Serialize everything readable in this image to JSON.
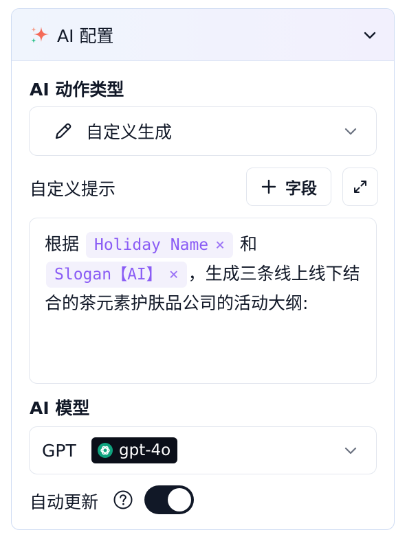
{
  "header": {
    "title": "AI 配置",
    "icon": "sparkle-icon",
    "collapse_icon": "chevron-down-icon"
  },
  "action_type": {
    "label": "AI 动作类型",
    "selected": "自定义生成",
    "icon": "pencil-icon"
  },
  "custom_prompt": {
    "label": "自定义提示",
    "add_field_label": "字段",
    "expand_icon": "expand-icon",
    "text_before": "根据",
    "chip1": "Holiday Name",
    "text_mid": "和",
    "chip2": "Slogan【AI】",
    "chip_remove": "×",
    "text_after": "，生成三条线上线下结合的茶元素护肤品公司的活动大纲:"
  },
  "model": {
    "label": "AI 模型",
    "provider": "GPT",
    "model_name": "gpt-4o"
  },
  "auto_update": {
    "label": "自动更新",
    "enabled": true
  },
  "colors": {
    "accent_purple": "#8a5cf5",
    "chip_bg": "#f3f1fc",
    "toggle_on": "#111827",
    "border": "#e2e6ee"
  }
}
